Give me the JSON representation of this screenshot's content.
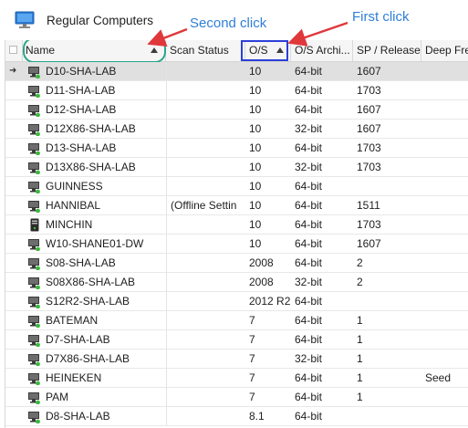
{
  "title": "Regular Computers",
  "annotations": {
    "second_click": "Second click",
    "first_click": "First click"
  },
  "columns": {
    "name": "Name",
    "scan_status": "Scan Status",
    "os": "O/S",
    "os_arch": "O/S Archi...",
    "sp_release": "SP / Release",
    "deep_freeze": "Deep Fre"
  },
  "rows": [
    {
      "icon": "pc-icon",
      "name": "D10-SHA-LAB",
      "scan": "",
      "os": "10",
      "arch": "64-bit",
      "sp": "1607",
      "deep": "",
      "selected": true
    },
    {
      "icon": "pc-icon",
      "name": "D11-SHA-LAB",
      "scan": "",
      "os": "10",
      "arch": "64-bit",
      "sp": "1703",
      "deep": ""
    },
    {
      "icon": "pc-icon",
      "name": "D12-SHA-LAB",
      "scan": "",
      "os": "10",
      "arch": "64-bit",
      "sp": "1607",
      "deep": ""
    },
    {
      "icon": "pc-icon",
      "name": "D12X86-SHA-LAB",
      "scan": "",
      "os": "10",
      "arch": "32-bit",
      "sp": "1607",
      "deep": ""
    },
    {
      "icon": "pc-icon",
      "name": "D13-SHA-LAB",
      "scan": "",
      "os": "10",
      "arch": "64-bit",
      "sp": "1703",
      "deep": ""
    },
    {
      "icon": "pc-icon",
      "name": "D13X86-SHA-LAB",
      "scan": "",
      "os": "10",
      "arch": "32-bit",
      "sp": "1703",
      "deep": ""
    },
    {
      "icon": "pc-icon",
      "name": "GUINNESS",
      "scan": "",
      "os": "10",
      "arch": "64-bit",
      "sp": "",
      "deep": ""
    },
    {
      "icon": "pc-icon",
      "name": "HANNIBAL",
      "scan": "(Offline Settin",
      "os": "10",
      "arch": "64-bit",
      "sp": "1511",
      "deep": ""
    },
    {
      "icon": "tower-icon",
      "name": "MINCHIN",
      "scan": "",
      "os": "10",
      "arch": "64-bit",
      "sp": "1703",
      "deep": ""
    },
    {
      "icon": "pc-icon",
      "name": "W10-SHANE01-DW",
      "scan": "",
      "os": "10",
      "arch": "64-bit",
      "sp": "1607",
      "deep": ""
    },
    {
      "icon": "pc-icon",
      "name": "S08-SHA-LAB",
      "scan": "",
      "os": "2008",
      "arch": "64-bit",
      "sp": "2",
      "deep": ""
    },
    {
      "icon": "pc-icon",
      "name": "S08X86-SHA-LAB",
      "scan": "",
      "os": "2008",
      "arch": "32-bit",
      "sp": "2",
      "deep": ""
    },
    {
      "icon": "pc-icon",
      "name": "S12R2-SHA-LAB",
      "scan": "",
      "os": "2012 R2",
      "arch": "64-bit",
      "sp": "",
      "deep": ""
    },
    {
      "icon": "pc-icon",
      "name": "BATEMAN",
      "scan": "",
      "os": "7",
      "arch": "64-bit",
      "sp": "1",
      "deep": ""
    },
    {
      "icon": "pc-icon",
      "name": "D7-SHA-LAB",
      "scan": "",
      "os": "7",
      "arch": "64-bit",
      "sp": "1",
      "deep": ""
    },
    {
      "icon": "pc-icon",
      "name": "D7X86-SHA-LAB",
      "scan": "",
      "os": "7",
      "arch": "32-bit",
      "sp": "1",
      "deep": ""
    },
    {
      "icon": "pc-icon",
      "name": "HEINEKEN",
      "scan": "",
      "os": "7",
      "arch": "64-bit",
      "sp": "1",
      "deep": "Seed"
    },
    {
      "icon": "pc-icon",
      "name": "PAM",
      "scan": "",
      "os": "7",
      "arch": "64-bit",
      "sp": "1",
      "deep": ""
    },
    {
      "icon": "pc-icon",
      "name": "D8-SHA-LAB",
      "scan": "",
      "os": "8.1",
      "arch": "64-bit",
      "sp": "",
      "deep": ""
    }
  ],
  "selected_indicator": "➜",
  "colors": {
    "annotation_text": "#2f7fd8",
    "annotation_arrow": "#e0373b",
    "name_highlight": "#2aa58a",
    "os_highlight": "#2b3fd8",
    "status_green": "#3db83d"
  }
}
